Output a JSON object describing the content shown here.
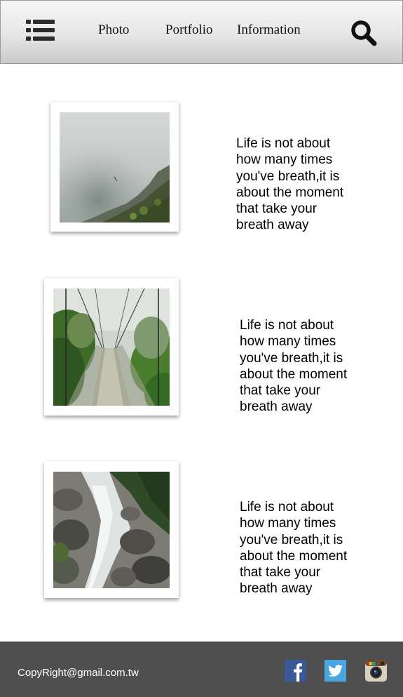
{
  "nav": {
    "links": [
      "Photo",
      "Portfolio",
      "Information"
    ]
  },
  "posts": [
    {
      "caption_lines": [
        "Life is not about",
        "how many times",
        "you've breath,it is",
        "about the moment",
        "that take your",
        "breath away"
      ],
      "photo": "misty cliff over sea"
    },
    {
      "caption_lines": [
        "Life is not about",
        "how many times",
        "you've breath,it is",
        "about the moment",
        "that take your",
        "breath away"
      ],
      "photo": "suspension bridge in forest"
    },
    {
      "caption_lines": [
        "Life is not about",
        "how many times",
        "you've breath,it is",
        "about the moment",
        "that take your",
        "breath away"
      ],
      "photo": "rocky river stream"
    }
  ],
  "footer": {
    "copyright": "CopyRight@gmail.com.tw",
    "social": [
      "facebook-icon",
      "twitter-icon",
      "instagram-icon"
    ]
  },
  "colors": {
    "footer_bg": "#4f4f4f",
    "facebook": "#3b5998",
    "twitter": "#4aa6e0"
  }
}
